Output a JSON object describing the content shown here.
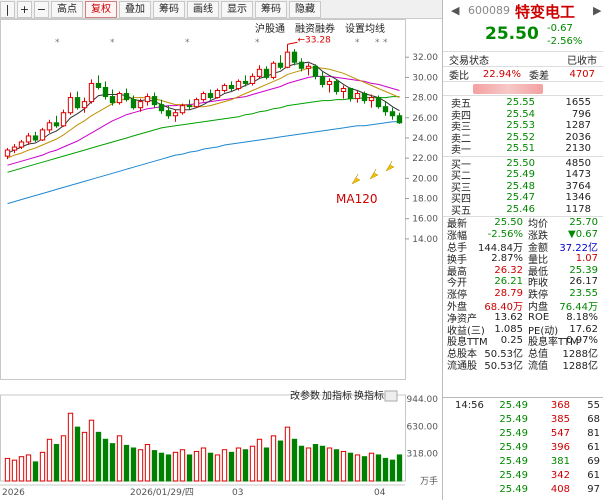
{
  "toolbar": {
    "buttons": [
      "|",
      "+",
      "−",
      "高点",
      "复权",
      "叠加",
      "筹码",
      "画线",
      "显示",
      "筹码",
      "隐藏"
    ],
    "active": "复权",
    "subbar": [
      "沪股通",
      "融资融券",
      "设置均线"
    ]
  },
  "chart": {
    "y_ticks": [
      "32.00",
      "30.00",
      "28.00",
      "26.00",
      "24.00",
      "22.00",
      "20.00",
      "18.00",
      "16.00",
      "14.00"
    ],
    "high_label": "33.28",
    "ma_label": "MA120",
    "indicator_bar": [
      "改参数",
      "加指标",
      "换指标"
    ],
    "vol_ticks": [
      "944.00",
      "630.00",
      "318.00",
      "万手"
    ],
    "x_labels": [
      "2026",
      "2026/01/29/四",
      "03",
      "04"
    ],
    "colors": {
      "up": "#e00000",
      "down": "#008000",
      "ma5": "#333333",
      "ma10": "#c09000",
      "ma20": "#cc00cc",
      "ma60": "#00a000",
      "ma120": "#1e88d0"
    }
  },
  "chart_data": {
    "type": "candlestick",
    "ylim": [
      13,
      34
    ],
    "candles": [
      [
        22.2,
        23.0,
        21.9,
        22.8
      ],
      [
        22.8,
        23.4,
        22.5,
        23.1
      ],
      [
        23.1,
        23.8,
        22.9,
        23.6
      ],
      [
        23.6,
        24.5,
        23.3,
        24.2
      ],
      [
        24.2,
        24.6,
        23.6,
        23.8
      ],
      [
        23.8,
        25.0,
        23.7,
        24.8
      ],
      [
        24.8,
        25.8,
        24.5,
        25.5
      ],
      [
        25.5,
        26.2,
        25.0,
        25.2
      ],
      [
        25.2,
        26.8,
        25.1,
        26.5
      ],
      [
        26.5,
        28.5,
        26.3,
        28.0
      ],
      [
        28.0,
        28.6,
        26.8,
        27.0
      ],
      [
        27.0,
        28.0,
        26.5,
        27.6
      ],
      [
        27.6,
        29.8,
        27.4,
        29.4
      ],
      [
        29.4,
        30.2,
        28.8,
        29.0
      ],
      [
        29.0,
        29.6,
        27.8,
        28.1
      ],
      [
        28.1,
        28.8,
        27.2,
        27.5
      ],
      [
        27.5,
        28.6,
        27.3,
        28.4
      ],
      [
        28.4,
        28.9,
        27.6,
        27.8
      ],
      [
        27.8,
        28.2,
        26.8,
        27.0
      ],
      [
        27.0,
        27.9,
        26.6,
        27.6
      ],
      [
        27.6,
        28.4,
        27.2,
        28.1
      ],
      [
        28.1,
        28.5,
        27.0,
        27.3
      ],
      [
        27.3,
        27.8,
        26.4,
        26.7
      ],
      [
        26.7,
        27.2,
        25.9,
        26.2
      ],
      [
        26.2,
        26.8,
        25.6,
        26.5
      ],
      [
        26.5,
        27.4,
        26.3,
        27.2
      ],
      [
        27.2,
        27.8,
        26.8,
        27.1
      ],
      [
        27.1,
        28.0,
        27.0,
        27.8
      ],
      [
        27.8,
        28.6,
        27.6,
        28.4
      ],
      [
        28.4,
        28.8,
        27.8,
        28.0
      ],
      [
        28.0,
        28.9,
        27.9,
        28.7
      ],
      [
        28.7,
        29.4,
        28.5,
        29.2
      ],
      [
        29.2,
        29.6,
        28.6,
        28.9
      ],
      [
        28.9,
        29.8,
        28.7,
        29.6
      ],
      [
        29.6,
        30.2,
        29.1,
        29.4
      ],
      [
        29.4,
        30.4,
        29.2,
        30.1
      ],
      [
        30.1,
        31.2,
        29.9,
        30.8
      ],
      [
        30.8,
        31.1,
        29.8,
        30.0
      ],
      [
        30.0,
        31.6,
        29.8,
        31.4
      ],
      [
        31.4,
        32.2,
        30.8,
        31.0
      ],
      [
        31.0,
        33.28,
        30.9,
        32.5
      ],
      [
        32.5,
        32.8,
        31.2,
        31.5
      ],
      [
        31.5,
        31.9,
        30.6,
        30.9
      ],
      [
        30.9,
        31.4,
        30.2,
        31.1
      ],
      [
        31.1,
        31.3,
        29.8,
        30.1
      ],
      [
        30.1,
        30.6,
        29.0,
        29.3
      ],
      [
        29.3,
        29.9,
        28.5,
        29.6
      ],
      [
        29.6,
        29.8,
        28.3,
        28.6
      ],
      [
        28.6,
        29.2,
        27.9,
        28.9
      ],
      [
        28.9,
        29.0,
        27.6,
        27.9
      ],
      [
        27.9,
        28.7,
        27.5,
        28.4
      ],
      [
        28.4,
        28.6,
        27.4,
        27.7
      ],
      [
        27.7,
        28.3,
        27.0,
        28.0
      ],
      [
        28.0,
        28.2,
        26.9,
        27.1
      ],
      [
        27.1,
        27.6,
        26.2,
        26.6
      ],
      [
        26.6,
        27.0,
        25.8,
        26.2
      ],
      [
        26.2,
        26.5,
        25.4,
        25.5
      ]
    ],
    "ma5": [
      22.5,
      22.8,
      23.1,
      23.4,
      23.5,
      23.9,
      24.4,
      24.7,
      25.2,
      26.0,
      26.4,
      26.9,
      27.6,
      28.2,
      28.3,
      28.3,
      28.3,
      28.2,
      27.8,
      27.7,
      27.8,
      27.6,
      27.3,
      27.0,
      26.8,
      26.8,
      26.8,
      27.0,
      27.3,
      27.7,
      28.0,
      28.4,
      28.6,
      28.9,
      29.2,
      29.5,
      29.9,
      30.1,
      30.4,
      30.6,
      31.1,
      31.3,
      31.4,
      31.5,
      31.2,
      30.6,
      30.2,
      29.8,
      29.3,
      28.9,
      28.7,
      28.4,
      28.2,
      28.0,
      27.6,
      27.1,
      26.7
    ],
    "ma10": [
      22.0,
      22.3,
      22.5,
      22.8,
      23.0,
      23.3,
      23.6,
      23.9,
      24.3,
      24.8,
      25.3,
      25.7,
      26.2,
      26.6,
      27.0,
      27.4,
      27.7,
      27.9,
      28.0,
      28.0,
      28.0,
      27.9,
      27.7,
      27.5,
      27.3,
      27.3,
      27.2,
      27.1,
      27.1,
      27.2,
      27.4,
      27.6,
      27.8,
      28.1,
      28.4,
      28.7,
      29.0,
      29.3,
      29.6,
      29.9,
      30.3,
      30.5,
      30.7,
      30.9,
      31.0,
      30.9,
      30.8,
      30.6,
      30.4,
      30.1,
      29.8,
      29.5,
      29.2,
      28.9,
      28.6,
      28.3,
      28.0
    ],
    "ma20": [
      21.3,
      21.5,
      21.7,
      21.9,
      22.1,
      22.3,
      22.6,
      22.8,
      23.1,
      23.4,
      23.7,
      24.1,
      24.5,
      24.9,
      25.3,
      25.7,
      26.0,
      26.3,
      26.5,
      26.7,
      26.9,
      27.0,
      27.1,
      27.2,
      27.2,
      27.3,
      27.3,
      27.4,
      27.5,
      27.6,
      27.7,
      27.8,
      27.9,
      28.0,
      28.1,
      28.3,
      28.5,
      28.7,
      28.9,
      29.1,
      29.4,
      29.6,
      29.8,
      30.0,
      30.1,
      30.1,
      30.1,
      30.0,
      29.9,
      29.8,
      29.7,
      29.6,
      29.4,
      29.3,
      29.1,
      28.9,
      28.7
    ],
    "ma60": [
      20.6,
      20.8,
      21.0,
      21.2,
      21.4,
      21.6,
      21.8,
      22.0,
      22.2,
      22.4,
      22.6,
      22.8,
      23.0,
      23.2,
      23.4,
      23.6,
      23.8,
      24.0,
      24.2,
      24.4,
      24.6,
      24.8,
      25.0,
      25.1,
      25.2,
      25.3,
      25.4,
      25.5,
      25.6,
      25.7,
      25.8,
      25.9,
      26.0,
      26.1,
      26.3,
      26.4,
      26.6,
      26.7,
      26.9,
      27.0,
      27.2,
      27.3,
      27.4,
      27.5,
      27.6,
      27.7,
      27.7,
      27.8,
      27.8,
      27.9,
      27.9,
      28.0,
      28.0,
      28.0,
      28.0,
      28.1,
      28.1
    ],
    "ma120": [
      17.5,
      17.7,
      17.9,
      18.1,
      18.3,
      18.5,
      18.7,
      18.9,
      19.1,
      19.3,
      19.5,
      19.7,
      19.9,
      20.1,
      20.3,
      20.5,
      20.7,
      20.9,
      21.1,
      21.3,
      21.5,
      21.7,
      21.9,
      22.1,
      22.3,
      22.4,
      22.6,
      22.7,
      22.9,
      23.0,
      23.1,
      23.3,
      23.4,
      23.5,
      23.6,
      23.7,
      23.8,
      23.9,
      24.0,
      24.1,
      24.2,
      24.3,
      24.4,
      24.5,
      24.6,
      24.7,
      24.8,
      24.9,
      25.0,
      25.1,
      25.2,
      25.2,
      25.3,
      25.4,
      25.5,
      25.6,
      25.6
    ],
    "volume": [
      260,
      240,
      280,
      300,
      220,
      330,
      480,
      420,
      520,
      780,
      620,
      560,
      700,
      560,
      480,
      430,
      520,
      410,
      380,
      360,
      420,
      350,
      320,
      300,
      330,
      360,
      300,
      340,
      380,
      320,
      300,
      360,
      330,
      380,
      360,
      400,
      480,
      380,
      520,
      460,
      620,
      480,
      400,
      380,
      420,
      400,
      380,
      360,
      340,
      320,
      300,
      280,
      320,
      300,
      260,
      240,
      300
    ],
    "vol_ylim": [
      0,
      944
    ]
  },
  "quote": {
    "code": "600089",
    "name": "特变电工",
    "price": "25.50",
    "change": "-0.67",
    "change_pct": "-2.56%",
    "status_label": "交易状态",
    "status_value": "已收市",
    "wb_label": "委比",
    "wb_value": "22.94%",
    "wc_label": "委差",
    "wc_value": "4707"
  },
  "order_book": {
    "asks": [
      {
        "label": "卖五",
        "price": "25.55",
        "vol": "1655"
      },
      {
        "label": "卖四",
        "price": "25.54",
        "vol": "796"
      },
      {
        "label": "卖三",
        "price": "25.53",
        "vol": "1287"
      },
      {
        "label": "卖二",
        "price": "25.52",
        "vol": "2036"
      },
      {
        "label": "卖一",
        "price": "25.51",
        "vol": "2130"
      }
    ],
    "bids": [
      {
        "label": "买一",
        "price": "25.50",
        "vol": "4850"
      },
      {
        "label": "买二",
        "price": "25.49",
        "vol": "1473"
      },
      {
        "label": "买三",
        "price": "25.48",
        "vol": "3764"
      },
      {
        "label": "买四",
        "price": "25.47",
        "vol": "1346"
      },
      {
        "label": "买五",
        "price": "25.46",
        "vol": "1178"
      }
    ]
  },
  "stats": [
    {
      "l1": "最新",
      "v1": "25.50",
      "c1": "green",
      "l2": "均价",
      "v2": "25.70",
      "c2": "green"
    },
    {
      "l1": "涨幅",
      "v1": "-2.56%",
      "c1": "green",
      "l2": "涨跌",
      "v2": "▼0.67",
      "c2": "green"
    },
    {
      "l1": "总手",
      "v1": "144.84万",
      "c1": "dark",
      "l2": "金额",
      "v2": "37.22亿",
      "c2": "blue"
    },
    {
      "l1": "换手",
      "v1": "2.87%",
      "c1": "dark",
      "l2": "量比",
      "v2": "1.07",
      "c2": "red"
    },
    {
      "l1": "最高",
      "v1": "26.32",
      "c1": "red",
      "l2": "最低",
      "v2": "25.39",
      "c2": "green"
    },
    {
      "l1": "今开",
      "v1": "26.21",
      "c1": "green",
      "l2": "昨收",
      "v2": "26.17",
      "c2": "dark"
    },
    {
      "l1": "涨停",
      "v1": "28.79",
      "c1": "red",
      "l2": "跌停",
      "v2": "23.55",
      "c2": "green"
    },
    {
      "l1": "外盘",
      "v1": "68.40万",
      "c1": "red",
      "l2": "内盘",
      "v2": "76.44万",
      "c2": "green"
    },
    {
      "l1": "净资产",
      "v1": "13.62",
      "c1": "dark",
      "l2": "ROE",
      "v2": "8.18%",
      "c2": "dark"
    },
    {
      "l1": "收益(三)",
      "v1": "1.085",
      "c1": "dark",
      "l2": "PE(动)",
      "v2": "17.62",
      "c2": "dark"
    },
    {
      "l1": "股息TTM",
      "v1": "0.25",
      "c1": "dark",
      "l2": "股息率TTM",
      "v2": "0.97%",
      "c2": "dark"
    },
    {
      "l1": "总股本",
      "v1": "50.53亿",
      "c1": "dark",
      "l2": "总值",
      "v2": "1288亿",
      "c2": "dark"
    },
    {
      "l1": "流通股",
      "v1": "50.53亿",
      "c1": "dark",
      "l2": "流值",
      "v2": "1288亿",
      "c2": "dark"
    }
  ],
  "ticks": [
    {
      "time": "14:56",
      "price": "25.49",
      "vol": "368",
      "n": "55",
      "vc": "red"
    },
    {
      "time": "",
      "price": "25.49",
      "vol": "385",
      "n": "68",
      "vc": "red"
    },
    {
      "time": "",
      "price": "25.49",
      "vol": "547",
      "n": "81",
      "vc": "red"
    },
    {
      "time": "",
      "price": "25.49",
      "vol": "396",
      "n": "61",
      "vc": "red"
    },
    {
      "time": "",
      "price": "25.49",
      "vol": "381",
      "n": "69",
      "vc": "green"
    },
    {
      "time": "",
      "price": "25.49",
      "vol": "342",
      "n": "61",
      "vc": "red"
    },
    {
      "time": "",
      "price": "25.49",
      "vol": "408",
      "n": "97",
      "vc": "red"
    }
  ]
}
